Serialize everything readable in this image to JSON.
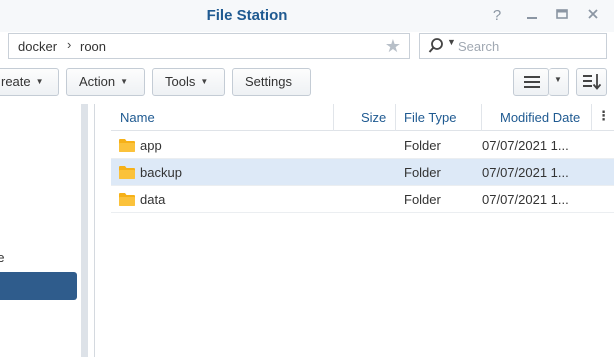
{
  "window": {
    "title": "File Station",
    "controls": {
      "help": "?",
      "minimize": "—",
      "maximize": "▭",
      "close": "✕"
    }
  },
  "path": {
    "crumbs": [
      "docker",
      "roon"
    ],
    "separator": "›"
  },
  "search": {
    "placeholder": "Search"
  },
  "toolbar": {
    "create_label": "reate",
    "action_label": "Action",
    "tools_label": "Tools",
    "settings_label": "Settings"
  },
  "sidebar": {
    "partial_item_label": "ge"
  },
  "table": {
    "columns": {
      "name": "Name",
      "size": "Size",
      "type": "File Type",
      "modified": "Modified Date"
    },
    "rows": [
      {
        "name": "app",
        "size": "",
        "type": "Folder",
        "modified": "07/07/2021 1..."
      },
      {
        "name": "backup",
        "size": "",
        "type": "Folder",
        "modified": "07/07/2021 1..."
      },
      {
        "name": "data",
        "size": "",
        "type": "Folder",
        "modified": "07/07/2021 1..."
      }
    ],
    "selected_row": "backup"
  },
  "colors": {
    "title": "#1f5a91",
    "selected_row": "#dde9f7",
    "sidebar_selected": "#2f5c8c",
    "folder": "#f6b118"
  },
  "icons": [
    "help-icon",
    "minimize-icon",
    "maximize-icon",
    "close-icon",
    "star-icon",
    "search-icon",
    "list-view-icon",
    "sort-icon",
    "folder-icon",
    "column-menu-icon"
  ]
}
